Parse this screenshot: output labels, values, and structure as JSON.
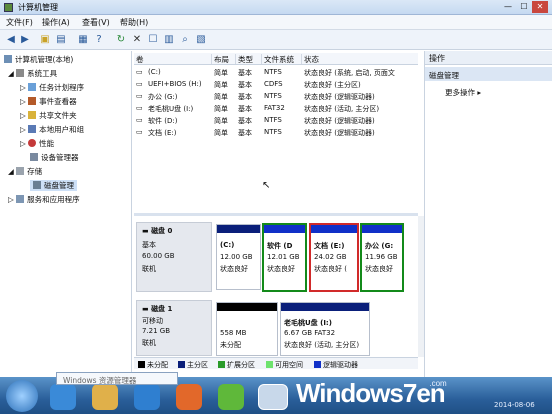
{
  "window": {
    "title": "计算机管理"
  },
  "menu": [
    "文件(F)",
    "操作(A)",
    "查看(V)",
    "帮助(H)"
  ],
  "tree": {
    "root": "计算机管理(本地)",
    "system_tools": "系统工具",
    "items": [
      "任务计划程序",
      "事件查看器",
      "共享文件夹",
      "本地用户和组",
      "性能",
      "设备管理器"
    ],
    "storage": "存储",
    "disk_mgmt": "磁盘管理",
    "services": "服务和应用程序"
  },
  "list_header": [
    "卷",
    "布局",
    "类型",
    "文件系统",
    "状态"
  ],
  "volumes": [
    {
      "name": "(C:)",
      "layout": "简单",
      "type": "基本",
      "fs": "NTFS",
      "status": "状态良好 (系统, 启动, 页面文"
    },
    {
      "name": "UEFI+BIOS (H:)",
      "layout": "简单",
      "type": "基本",
      "fs": "CDFS",
      "status": "状态良好 (主分区)"
    },
    {
      "name": "办公 (G:)",
      "layout": "简单",
      "type": "基本",
      "fs": "NTFS",
      "status": "状态良好 (逻辑驱动器)"
    },
    {
      "name": "老毛桃U盘 (I:)",
      "layout": "简单",
      "type": "基本",
      "fs": "FAT32",
      "status": "状态良好 (活动, 主分区)"
    },
    {
      "name": "软件 (D:)",
      "layout": "简单",
      "type": "基本",
      "fs": "NTFS",
      "status": "状态良好 (逻辑驱动器)"
    },
    {
      "name": "文档 (E:)",
      "layout": "简单",
      "type": "基本",
      "fs": "NTFS",
      "status": "状态良好 (逻辑驱动器)"
    }
  ],
  "disk0": {
    "label": "磁盘 0",
    "kind": "基本",
    "size": "60.00 GB",
    "state": "联机",
    "partitions": [
      {
        "name": "(C:)",
        "size": "12.00 GB",
        "status": "状态良好"
      },
      {
        "name": "软件 (D",
        "size": "12.01 GB",
        "status": "状态良好"
      },
      {
        "name": "文档 (E:)",
        "size": "24.02 GB",
        "status": "状态良好 ("
      },
      {
        "name": "办公 (G:",
        "size": "11.96 GB",
        "status": "状态良好"
      }
    ]
  },
  "disk1": {
    "label": "磁盘 1",
    "kind": "可移动",
    "size": "7.21 GB",
    "state": "联机",
    "partitions": [
      {
        "name": "",
        "size": "558 MB",
        "status": "未分配"
      },
      {
        "name": "老毛桃U盘 (I:)",
        "size": "6.67 GB FAT32",
        "status": "状态良好 (活动, 主分区)"
      }
    ]
  },
  "legend": [
    "未分配",
    "主分区",
    "扩展分区",
    "可用空间",
    "逻辑驱动器"
  ],
  "actions": {
    "header": "操作",
    "section": "磁盘管理",
    "more": "更多操作"
  },
  "taskbar": {
    "tooltip": "Windows 资源管理器",
    "clock": "2014-08-06"
  },
  "brand": {
    "text_main": "Windows",
    "text_seven": "7",
    "text_tail": "en",
    "site": ".com"
  },
  "colors": {
    "unallocated": "#000000",
    "primary": "#0a1f7a",
    "extended": "#2a9b2a",
    "free": "#6ee36e",
    "logical": "#1030c8"
  }
}
